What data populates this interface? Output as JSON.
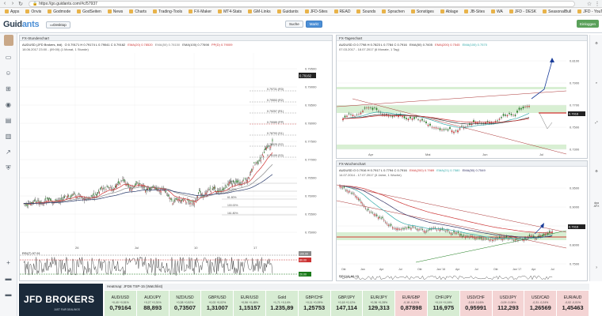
{
  "browser": {
    "url": "https://go.guidants.com/#c/57937",
    "bookmarks": [
      "Apps",
      "Onvis",
      "Godmode",
      "GodSeiten",
      "News",
      "Charts",
      "Trading-Tools",
      "FX-Maker",
      "MT4-Stats",
      "GM-Links",
      "Guidants",
      "JFD-Sites",
      "READ",
      "Sounds",
      "Sprachen",
      "Sonstiges",
      "Ablage",
      "JB-Sites",
      "WA",
      "JFD - DESK",
      "SeasonalBull",
      "JFD - YouTube"
    ]
  },
  "header": {
    "logo_a": "Guid",
    "logo_b": "ants",
    "btn_search": "Suche",
    "btn_market": "Markt",
    "btn_desktop": "Desktop",
    "btn_login": "Einloggen"
  },
  "main_chart": {
    "title": "FX-Stundenchart",
    "symbol_line": "AUDUSD (JFD Brokers, bid)",
    "ohlc": "O 0.79171  H 0.79174  L 0.79041  C 0.79162",
    "ema20": "EMA(20) 0.78520",
    "ema50": "EMA(50) 0.78150",
    "ema100": "EMA(100) 0.77698",
    "pp": "PP(D) 0.79009",
    "date_line": "18.06.2017 23:00 - (09:00)  (1 Monat, 1 Stunde)",
    "last_price": "0.79162",
    "levels": [
      "0.79731 (R3)",
      "0.79553 (R2)",
      "0.79257 (R1)",
      "0.79089 (PP)",
      "0.78793 (S1)",
      "0.78425 (S2)",
      "0.78109 (S3)"
    ],
    "fib_labels": [
      "0.00%",
      "38.20%",
      "61.80%",
      "100.00%",
      "161.80%"
    ],
    "price_ticks": [
      "0.79500",
      "0.79000",
      "0.78500",
      "0.78000",
      "0.77500",
      "0.77000",
      "0.76500",
      "0.76000",
      "0.75500",
      "0.75000"
    ],
    "x_ticks": [
      "26",
      "Jul",
      "10",
      "17"
    ],
    "rsi_label": "RSI(7)  97.91",
    "rsi_levels": [
      "100.00",
      "80.00",
      "20.00"
    ]
  },
  "daily_chart": {
    "title": "FX-Tageschart",
    "symbol_line": "AUDUSD  O 0.7798  H 0.7823  L 0.7784  C 0.7916",
    "ema50": "EMA(50) 0.7605",
    "ema200": "EMA(200) 0.7545",
    "ema100": "EMA(100) 0.7570",
    "date_line": "07.03.2017 - 18.07.2017  (6 Monate, 1 Tag)",
    "price_ticks": [
      "0.8100",
      "0.7900",
      "0.7700",
      "0.7500",
      "0.7300"
    ],
    "x_ticks": [
      "Apr",
      "Mai",
      "Jun",
      "Jul"
    ],
    "tag": "0.7916"
  },
  "weekly_chart": {
    "title": "FX-Wochenchart",
    "symbol_line": "AUDUSD  O 0.7916  H 0.7917  L 0.7794  C 0.7916",
    "ema200": "EMA(200) 0.7989",
    "ema21": "EMA(21) 0.7580",
    "ema50": "EMA(50) 0.7549",
    "date_line": "14.07.2014 - 17.07.2017  (3 Jahre, 1 Woche)",
    "price_ticks": [
      "0.9500",
      "0.9000",
      "0.8500",
      "0.8000",
      "0.7500"
    ],
    "x_ticks": [
      "Okt",
      "Jan",
      "Apr",
      "Jul",
      "Okt",
      "Jan '16",
      "Apr",
      "Jul",
      "Okt",
      "Jan '17",
      "Apr",
      "Jul"
    ],
    "rsi_label": "RSI(14) 66.15",
    "tag": "0.7916"
  },
  "ticker_bar": {
    "header": "Heatmap: JFD6 TSP-15 (Watchlist)",
    "jfd_logo": "JFD BROKERS",
    "jfd_tagline": "JUST FAIR DEALINGS",
    "items": [
      {
        "sym": "AUD/USD",
        "val": "0,79164",
        "chg": "+0,40 +0,51%",
        "tone": "green"
      },
      {
        "sym": "AUD/JPY",
        "val": "88,893",
        "chg": "+0,27 +0,31%",
        "tone": "green"
      },
      {
        "sym": "NZD/USD",
        "val": "0,73507",
        "chg": "+0,38 +0,52%",
        "tone": "green"
      },
      {
        "sym": "GBP/USD",
        "val": "1,31007",
        "chg": "+0,03 +0,02%",
        "tone": "green"
      },
      {
        "sym": "EUR/USD",
        "val": "1,15157",
        "chg": "+0,56 +0,48%",
        "tone": "green"
      },
      {
        "sym": "Gold",
        "val": "1.235,89",
        "chg": "+1,71 +0,14%",
        "tone": "green"
      },
      {
        "sym": "GBP/CHF",
        "val": "1,25753",
        "chg": "+0,11 +0,09%",
        "tone": "green"
      },
      {
        "sym": "GBP/JPY",
        "val": "147,114",
        "chg": "+0,18 +0,12%",
        "tone": "green"
      },
      {
        "sym": "EUR/JPY",
        "val": "129,313",
        "chg": "+0,36 +0,28%",
        "tone": "green"
      },
      {
        "sym": "EUR/GBP",
        "val": "0,87898",
        "chg": "-0,18 -0,21%",
        "tone": "pink"
      },
      {
        "sym": "CHF/JPY",
        "val": "116,975",
        "chg": "+0,19 +0,16%",
        "tone": "green"
      },
      {
        "sym": "USD/CHF",
        "val": "0,95991",
        "chg": "-0,15 -0,16%",
        "tone": "pink"
      },
      {
        "sym": "USD/JPY",
        "val": "112,293",
        "chg": "-0,09 -0,08%",
        "tone": "pink"
      },
      {
        "sym": "USD/CAD",
        "val": "1,26569",
        "chg": "-0,31 -0,24%",
        "tone": "pink"
      },
      {
        "sym": "EUR/AUD",
        "val": "1,45463",
        "chg": "-0,02 -0,01%",
        "tone": "pink"
      }
    ]
  }
}
